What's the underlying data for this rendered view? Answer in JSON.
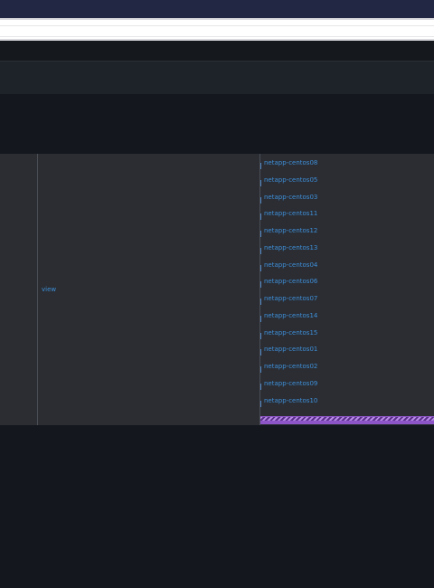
{
  "table": {
    "view_link": "view",
    "hosts": [
      "netapp-centos08",
      "netapp-centos05",
      "netapp-centos03",
      "netapp-centos11",
      "netapp-centos12",
      "netapp-centos13",
      "netapp-centos04",
      "netapp-centos06",
      "netapp-centos07",
      "netapp-centos14",
      "netapp-centos15",
      "netapp-centos01",
      "netapp-centos02",
      "netapp-centos09",
      "netapp-centos10"
    ]
  },
  "colors": {
    "link": "#3e8fd8",
    "progress": "#8e55c8",
    "topbar": "#222844",
    "background": "#14171d"
  }
}
